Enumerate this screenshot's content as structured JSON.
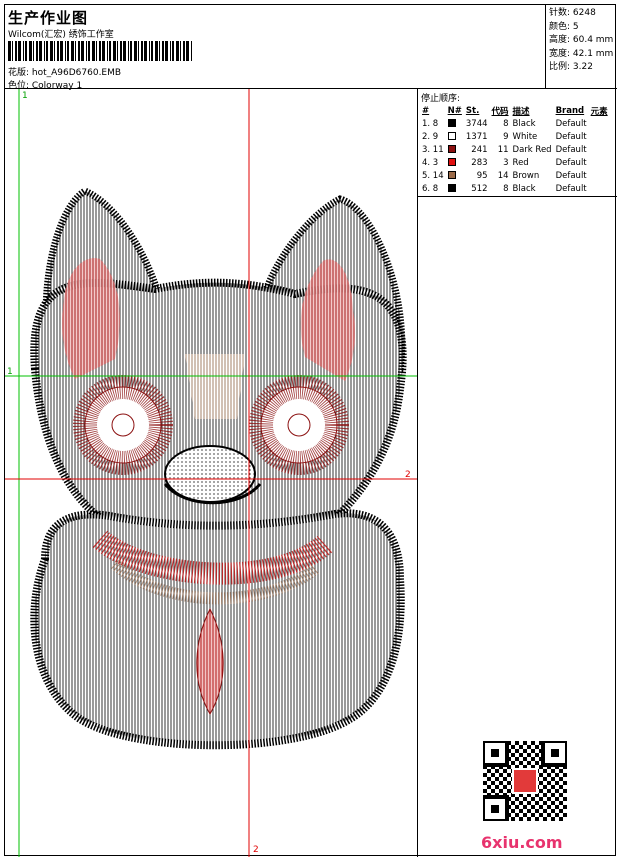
{
  "header": {
    "title": "生产作业图",
    "studio": "Wilcom(汇宏) 绣饰工作室",
    "design_file": "花版: hot_A96D6760.EMB",
    "colorway": "色位: Colorway 1"
  },
  "stats": {
    "stitches": "针数: 6248",
    "colors": "颜色: 5",
    "height": "高度: 60.4 mm",
    "width": "宽度: 42.1 mm",
    "scale": "比例: 3.22"
  },
  "sequence": {
    "title": "停止顺序:",
    "headers": {
      "index": "#",
      "needle": "N#",
      "stitches": "St.",
      "code": "代码",
      "description": "描述",
      "brand": "Brand",
      "element": "元素"
    },
    "rows": [
      {
        "index": "1. 8",
        "stitches": "3744",
        "code": "8",
        "description": "Black",
        "brand": "Default",
        "color": "#000000"
      },
      {
        "index": "2. 9",
        "stitches": "1371",
        "code": "9",
        "description": "White",
        "brand": "Default",
        "color": "#ffffff"
      },
      {
        "index": "3. 11",
        "stitches": "241",
        "code": "11",
        "description": "Dark Red",
        "brand": "Default",
        "color": "#8b1010"
      },
      {
        "index": "4. 3",
        "stitches": "283",
        "code": "3",
        "description": "Red",
        "brand": "Default",
        "color": "#e01010"
      },
      {
        "index": "5. 14",
        "stitches": "95",
        "code": "14",
        "description": "Brown",
        "brand": "Default",
        "color": "#9b6a48"
      },
      {
        "index": "6. 8",
        "stitches": "512",
        "code": "8",
        "description": "Black",
        "brand": "Default",
        "color": "#000000"
      }
    ]
  },
  "guides": {
    "top_marker": "1",
    "left_marker": "1",
    "right_marker": "2",
    "bottom_marker": "2"
  },
  "watermark": {
    "site": "6xiu.com",
    "qr_label": "QR code"
  }
}
